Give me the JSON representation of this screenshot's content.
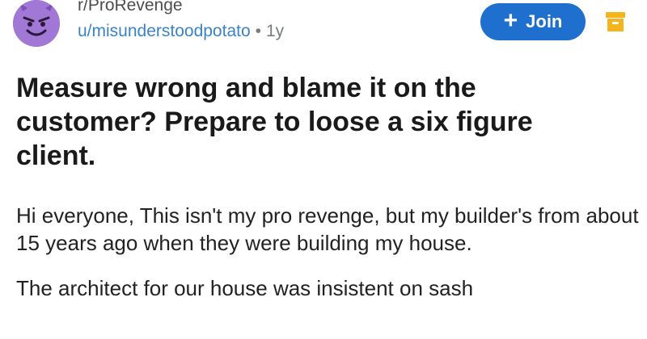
{
  "post": {
    "subreddit": "r/ProRevenge",
    "username": "u/misunderstoodpotato",
    "separator": "•",
    "age": "1y",
    "join_label": "Join",
    "title": "Measure wrong and blame it on the customer? Prepare to loose a six figure client.",
    "body": [
      "Hi everyone, This isn't my pro revenge, but my builder's from about 15 years ago when they were building my house.",
      "The architect for our house was insistent on sash"
    ]
  },
  "icons": {
    "avatar": "devil-face-icon",
    "join": "plus-icon",
    "award": "award-box-icon"
  },
  "colors": {
    "accent": "#1f6fcf",
    "username": "#3b83c6",
    "avatar_bg": "#a178d6",
    "award": "#f3b51b"
  }
}
